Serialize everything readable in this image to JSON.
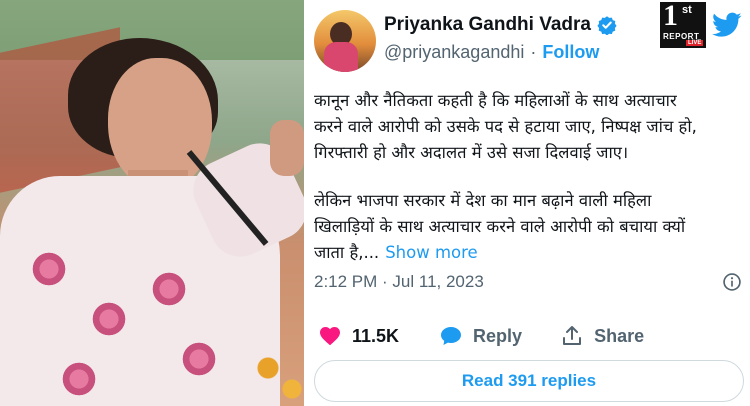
{
  "tweet": {
    "author_name": "Priyanka Gandhi Vadra",
    "handle": "@priyankagandhi",
    "separator": "·",
    "follow_label": "Follow",
    "paragraph_1": "कानून और नैतिकता कहती है कि महिलाओं के साथ अत्याचार\nकरने वाले आरोपी को उसके पद से हटाया जाए, निष्पक्ष जांच हो,\nगिरफ्तारी हो और अदालत में उसे सजा दिलवाई जाए।",
    "paragraph_2": "लेकिन भाजपा सरकार में देश का मान बढ़ाने वाली महिला\nखिलाड़ियों के साथ अत्याचार करने वाले आरोपी को बचाया क्यों\nजाता है,...",
    "show_more_label": "Show more",
    "timestamp": "2:12 PM · Jul 11, 2023",
    "likes_count": "11.5K",
    "reply_label": "Reply",
    "share_label": "Share",
    "read_replies_label": "Read 391 replies"
  },
  "watermark": {
    "logo_text_main": "1",
    "logo_text_sup": "st",
    "logo_text_report": "REPORT",
    "logo_text_live": "LIVE"
  },
  "colors": {
    "accent": "#1d9bf0",
    "like": "#f91880",
    "text": "#0f1419",
    "muted": "#536471",
    "border": "#cfd9de"
  },
  "icons": [
    "verified-badge-icon",
    "twitter-bird-icon",
    "info-icon",
    "heart-icon",
    "reply-bubble-icon",
    "share-icon"
  ]
}
